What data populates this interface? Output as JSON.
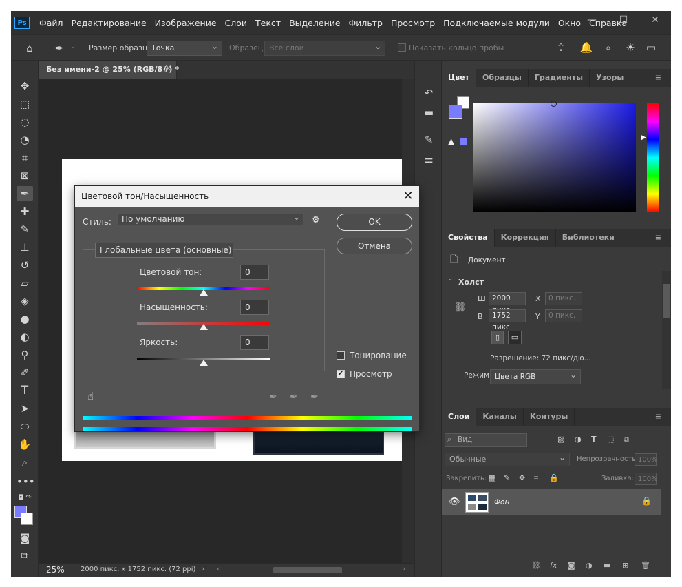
{
  "app": {
    "logo": "Ps",
    "menu": [
      "Файл",
      "Редактирование",
      "Изображение",
      "Слои",
      "Текст",
      "Выделение",
      "Фильтр",
      "Просмотр",
      "Подключаемые модули",
      "Окно",
      "Справка"
    ],
    "window_controls": [
      "—",
      "☐",
      "✕"
    ]
  },
  "optbar": {
    "sample_size_label": "Размер образца:",
    "sample_size_value": "Точка",
    "sample_label": "Образец:",
    "sample_value": "Все слои",
    "ring_label": "Показать кольцо пробы"
  },
  "document": {
    "tab_title": "Без имени-2 @ 25% (RGB/8#) *",
    "tab_close": "×",
    "zoom": "25%",
    "status_info": "2000 пикс. x 1752 пикс. (72 ppi)"
  },
  "color_panel": {
    "tabs": [
      "Цвет",
      "Образцы",
      "Градиенты",
      "Узоры"
    ],
    "fg_color": "#7b7bff",
    "bg_color": "#ffffff",
    "hue_color": "#1a1ae6"
  },
  "properties_panel": {
    "tabs": [
      "Свойства",
      "Коррекция",
      "Библиотеки"
    ],
    "doc_label": "Документ",
    "canvas_label": "Холст",
    "w_label": "Ш",
    "h_label": "В",
    "x_label": "X",
    "y_label": "Y",
    "width_value": "2000 пикс",
    "height_value": "1752 пикс",
    "x_placeholder": "0 пикс.",
    "y_placeholder": "0 пикс.",
    "resolution": "Разрешение: 72 пикс/дю...",
    "mode_label": "Режим",
    "mode_value": "Цвета RGB"
  },
  "layers_panel": {
    "tabs": [
      "Слои",
      "Каналы",
      "Контуры"
    ],
    "search_placeholder": "Вид",
    "blend_mode": "Обычные",
    "opacity_label": "Непрозрачность:",
    "opacity_value": "100%",
    "lock_label": "Закрепить:",
    "fill_label": "Заливка:",
    "fill_value": "100%",
    "layer_name": "Фон"
  },
  "dialog": {
    "title": "Цветовой тон/Насыщенность",
    "close": "✕",
    "style_label": "Стиль:",
    "style_value": "По умолчанию",
    "ok": "OK",
    "cancel": "Отмена",
    "range_value": "Глобальные цвета (основные)",
    "hue_label": "Цветовой тон:",
    "hue_value": "0",
    "saturation_label": "Насыщенность:",
    "saturation_value": "0",
    "brightness_label": "Яркость:",
    "brightness_value": "0",
    "colorize_label": "Тонирование",
    "preview_label": "Просмотр",
    "preview_checked": "✔",
    "hue_slider_position": 0.5,
    "saturation_slider_position": 0.5,
    "brightness_slider_position": 0.5
  }
}
